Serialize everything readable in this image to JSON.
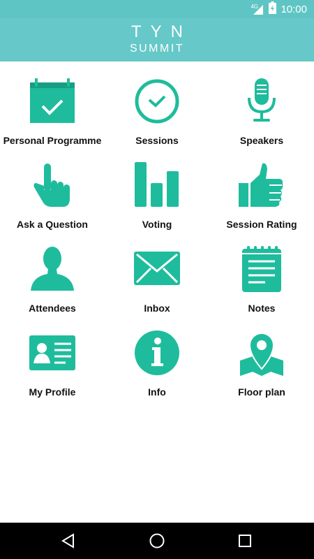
{
  "status": {
    "network": "4G",
    "time": "10:00"
  },
  "app": {
    "title": "TYN",
    "subtitle": "SUMMIT"
  },
  "colors": {
    "accent": "#1ebc9c",
    "header": "#66c8c8"
  },
  "tiles": [
    {
      "label": "Personal Programme",
      "icon": "calendar-check-icon"
    },
    {
      "label": "Sessions",
      "icon": "clock-check-icon"
    },
    {
      "label": "Speakers",
      "icon": "microphone-icon"
    },
    {
      "label": "Ask a Question",
      "icon": "hand-pointer-icon"
    },
    {
      "label": "Voting",
      "icon": "bar-chart-icon"
    },
    {
      "label": "Session Rating",
      "icon": "thumbs-up-icon"
    },
    {
      "label": "Attendees",
      "icon": "person-icon"
    },
    {
      "label": "Inbox",
      "icon": "envelope-icon"
    },
    {
      "label": "Notes",
      "icon": "notepad-icon"
    },
    {
      "label": "My Profile",
      "icon": "id-card-icon"
    },
    {
      "label": "Info",
      "icon": "info-icon"
    },
    {
      "label": "Floor plan",
      "icon": "map-pin-icon"
    }
  ],
  "navigation": {
    "back": "back-icon",
    "home": "home-icon",
    "recents": "recents-icon"
  }
}
